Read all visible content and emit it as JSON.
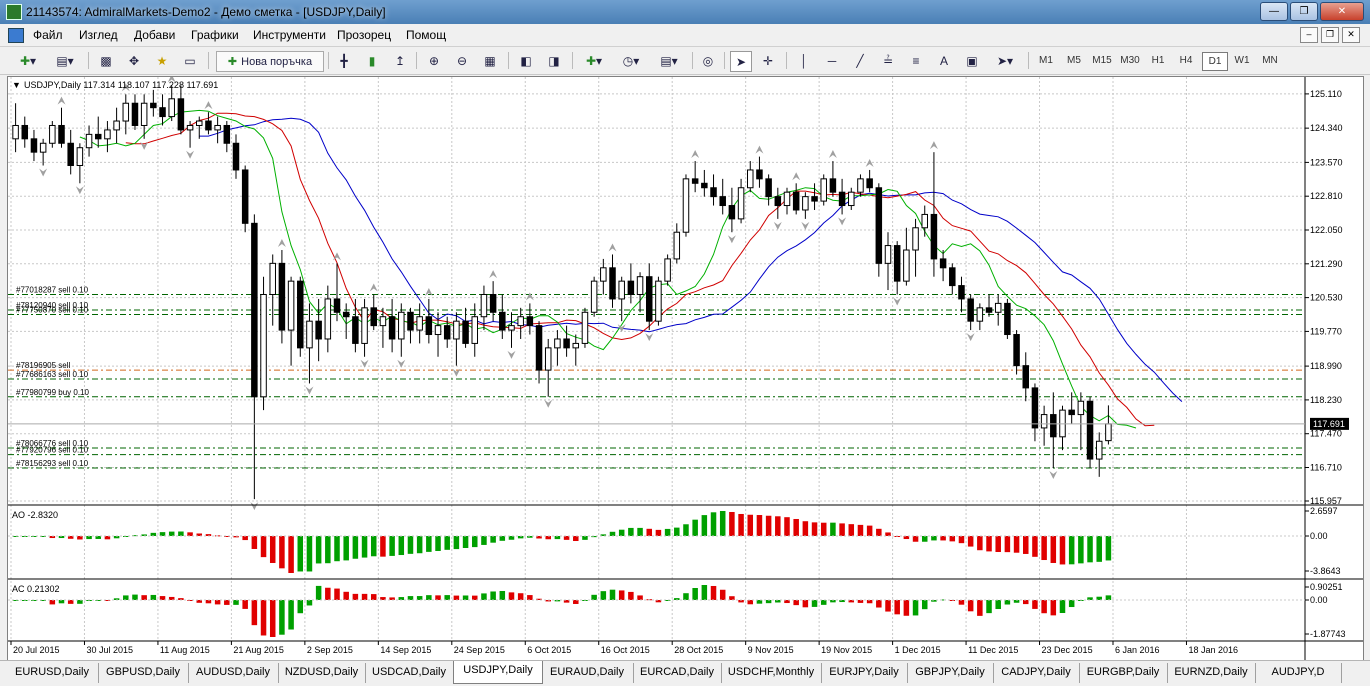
{
  "window": {
    "title": "21143574: AdmiralMarkets-Demo2 - Демо сметка - [USDJPY,Daily]"
  },
  "menu": {
    "items": [
      "Файл",
      "Изглед",
      "Добави",
      "Графики",
      "Инструменти",
      "Прозорец",
      "Помощ"
    ]
  },
  "toolbar": {
    "new_order_label": "Нова поръчка",
    "timeframes": [
      "M1",
      "M5",
      "M15",
      "M30",
      "H1",
      "H4",
      "D1",
      "W1",
      "MN"
    ],
    "active_timeframe": "D1"
  },
  "chart": {
    "header": "USDJPY,Daily  117.314 118.107 117.228 117.691",
    "current_price": "117.691",
    "price_ticks": [
      "125.110",
      "124.340",
      "123.570",
      "122.810",
      "122.050",
      "121.290",
      "120.530",
      "119.770",
      "118.990",
      "118.230",
      "117.470",
      "116.710",
      "115.957"
    ],
    "date_ticks": [
      "20 Jul 2015",
      "30 Jul 2015",
      "11 Aug 2015",
      "21 Aug 2015",
      "2 Sep 2015",
      "14 Sep 2015",
      "24 Sep 2015",
      "6 Oct 2015",
      "16 Oct 2015",
      "28 Oct 2015",
      "9 Nov 2015",
      "19 Nov 2015",
      "1 Dec 2015",
      "11 Dec 2015",
      "23 Dec 2015",
      "6 Jan 2016",
      "18 Jan 2016"
    ],
    "order_labels": [
      "#77018287 sell 0.10",
      "#78120940 sell 0.10",
      "#77750870 sell 0.10",
      "#78196905 sell",
      "#77686163 sell 0.10",
      "#77980799 buy 0.10",
      "#78066776 sell 0.10",
      "#77920796 sell 0.10",
      "#78156293 sell 0.10"
    ],
    "colors": {
      "ma_fast": "#00b000",
      "ma_mid": "#d00000",
      "ma_slow": "#0000c8",
      "order_line": "#006400",
      "order_line_alt": "#d2691e",
      "bull": "#00a000",
      "bear": "#e00000"
    }
  },
  "ao": {
    "label": "AO -2.8320",
    "ticks": [
      "2.6597",
      "0.00",
      "-3.8643"
    ]
  },
  "ac": {
    "label": "AC 0.21302",
    "ticks": [
      "0.90251",
      "0.00",
      "-1.87743"
    ]
  },
  "tabs": [
    "EURUSD,Daily",
    "GBPUSD,Daily",
    "AUDUSD,Daily",
    "NZDUSD,Daily",
    "USDCAD,Daily",
    "USDJPY,Daily",
    "EURAUD,Daily",
    "EURCAD,Daily",
    "USDCHF,Monthly",
    "EURJPY,Daily",
    "GBPJPY,Daily",
    "CADJPY,Daily",
    "EURGBP,Daily",
    "EURNZD,Daily",
    "AUDJPY,D"
  ],
  "active_tab": "USDJPY,Daily",
  "chart_data": {
    "type": "candlestick",
    "symbol": "USDJPY",
    "timeframe": "Daily",
    "ohlc": [
      [
        124.1,
        124.9,
        123.8,
        124.4
      ],
      [
        124.4,
        124.6,
        123.9,
        124.1
      ],
      [
        124.1,
        124.3,
        123.6,
        123.8
      ],
      [
        123.8,
        124.1,
        123.5,
        124.0
      ],
      [
        124.0,
        124.5,
        123.9,
        124.4
      ],
      [
        124.4,
        124.8,
        123.9,
        124.0
      ],
      [
        124.0,
        124.3,
        123.3,
        123.5
      ],
      [
        123.5,
        124.0,
        123.1,
        123.9
      ],
      [
        123.9,
        124.4,
        123.7,
        124.2
      ],
      [
        124.2,
        124.6,
        123.9,
        124.1
      ],
      [
        124.1,
        124.5,
        123.8,
        124.3
      ],
      [
        124.3,
        124.8,
        124.0,
        124.5
      ],
      [
        124.5,
        125.1,
        124.2,
        124.9
      ],
      [
        124.9,
        125.1,
        124.3,
        124.4
      ],
      [
        124.4,
        125.1,
        124.1,
        124.9
      ],
      [
        124.9,
        125.2,
        124.6,
        124.8
      ],
      [
        124.8,
        125.1,
        124.4,
        124.6
      ],
      [
        124.6,
        125.3,
        124.5,
        125.0
      ],
      [
        125.0,
        125.3,
        124.2,
        124.3
      ],
      [
        124.3,
        124.5,
        123.9,
        124.4
      ],
      [
        124.4,
        124.6,
        124.1,
        124.5
      ],
      [
        124.5,
        124.7,
        124.2,
        124.3
      ],
      [
        124.3,
        124.6,
        124.0,
        124.4
      ],
      [
        124.4,
        124.5,
        123.8,
        124.0
      ],
      [
        124.0,
        124.2,
        123.2,
        123.4
      ],
      [
        123.4,
        123.5,
        122.0,
        122.2
      ],
      [
        122.2,
        122.4,
        116.0,
        118.3
      ],
      [
        118.3,
        121.0,
        118.0,
        120.6
      ],
      [
        120.6,
        121.5,
        119.9,
        121.3
      ],
      [
        121.3,
        121.6,
        119.5,
        119.8
      ],
      [
        119.8,
        121.0,
        119.0,
        120.9
      ],
      [
        120.9,
        121.0,
        119.2,
        119.4
      ],
      [
        119.4,
        120.4,
        118.6,
        120.0
      ],
      [
        120.0,
        120.5,
        119.1,
        119.6
      ],
      [
        119.6,
        120.8,
        119.3,
        120.5
      ],
      [
        120.5,
        121.3,
        120.0,
        120.2
      ],
      [
        120.2,
        120.4,
        119.6,
        120.1
      ],
      [
        120.1,
        120.5,
        119.3,
        119.5
      ],
      [
        119.5,
        120.5,
        119.2,
        120.3
      ],
      [
        120.3,
        120.6,
        119.8,
        119.9
      ],
      [
        119.9,
        120.3,
        119.4,
        120.1
      ],
      [
        120.1,
        120.5,
        119.3,
        119.6
      ],
      [
        119.6,
        120.4,
        119.2,
        120.2
      ],
      [
        120.2,
        120.3,
        119.5,
        119.8
      ],
      [
        119.8,
        120.4,
        119.5,
        120.1
      ],
      [
        120.1,
        120.5,
        119.5,
        119.7
      ],
      [
        119.7,
        120.2,
        119.2,
        119.9
      ],
      [
        119.9,
        120.1,
        119.4,
        119.6
      ],
      [
        119.6,
        120.2,
        119.0,
        120.0
      ],
      [
        120.0,
        120.3,
        119.4,
        119.5
      ],
      [
        119.5,
        120.4,
        119.2,
        120.1
      ],
      [
        120.1,
        120.8,
        119.8,
        120.6
      ],
      [
        120.6,
        120.9,
        120.0,
        120.2
      ],
      [
        120.2,
        120.6,
        119.6,
        119.8
      ],
      [
        119.8,
        120.2,
        119.4,
        119.9
      ],
      [
        119.9,
        120.3,
        119.6,
        120.1
      ],
      [
        120.1,
        120.4,
        119.7,
        119.9
      ],
      [
        119.9,
        120.0,
        118.6,
        118.9
      ],
      [
        118.9,
        119.6,
        118.3,
        119.4
      ],
      [
        119.4,
        119.8,
        119.0,
        119.6
      ],
      [
        119.6,
        119.9,
        119.2,
        119.4
      ],
      [
        119.4,
        119.7,
        119.0,
        119.5
      ],
      [
        119.5,
        120.3,
        119.4,
        120.2
      ],
      [
        120.2,
        121.0,
        120.1,
        120.9
      ],
      [
        120.9,
        121.4,
        120.6,
        121.2
      ],
      [
        121.2,
        121.5,
        120.3,
        120.5
      ],
      [
        120.5,
        121.0,
        120.0,
        120.9
      ],
      [
        120.9,
        121.3,
        120.4,
        120.6
      ],
      [
        120.6,
        121.1,
        120.2,
        121.0
      ],
      [
        121.0,
        121.3,
        119.8,
        120.0
      ],
      [
        120.0,
        121.0,
        119.9,
        120.9
      ],
      [
        120.9,
        121.5,
        120.8,
        121.4
      ],
      [
        121.4,
        122.2,
        121.3,
        122.0
      ],
      [
        122.0,
        123.3,
        121.9,
        123.2
      ],
      [
        123.2,
        123.6,
        122.9,
        123.1
      ],
      [
        123.1,
        123.4,
        122.8,
        123.0
      ],
      [
        123.0,
        123.3,
        122.6,
        122.8
      ],
      [
        122.8,
        123.2,
        122.4,
        122.6
      ],
      [
        122.6,
        123.0,
        122.0,
        122.3
      ],
      [
        122.3,
        123.2,
        122.2,
        123.0
      ],
      [
        123.0,
        123.6,
        122.9,
        123.4
      ],
      [
        123.4,
        123.7,
        123.0,
        123.2
      ],
      [
        123.2,
        123.3,
        122.6,
        122.8
      ],
      [
        122.8,
        123.0,
        122.3,
        122.6
      ],
      [
        122.6,
        123.0,
        122.4,
        122.9
      ],
      [
        122.9,
        123.1,
        122.4,
        122.5
      ],
      [
        122.5,
        122.9,
        122.3,
        122.8
      ],
      [
        122.8,
        123.1,
        122.5,
        122.7
      ],
      [
        122.7,
        123.3,
        122.6,
        123.2
      ],
      [
        123.2,
        123.6,
        122.8,
        122.9
      ],
      [
        122.9,
        123.2,
        122.4,
        122.6
      ],
      [
        122.6,
        123.0,
        122.5,
        122.9
      ],
      [
        122.9,
        123.3,
        122.8,
        123.2
      ],
      [
        123.2,
        123.4,
        122.9,
        123.0
      ],
      [
        123.0,
        123.1,
        121.0,
        121.3
      ],
      [
        121.3,
        122.0,
        120.7,
        121.7
      ],
      [
        121.7,
        121.8,
        120.6,
        120.9
      ],
      [
        120.9,
        122.1,
        120.8,
        121.6
      ],
      [
        121.6,
        122.3,
        121.0,
        122.1
      ],
      [
        122.1,
        122.6,
        121.9,
        122.4
      ],
      [
        122.4,
        123.8,
        121.0,
        121.4
      ],
      [
        121.4,
        121.6,
        120.9,
        121.2
      ],
      [
        121.2,
        121.3,
        120.6,
        120.8
      ],
      [
        120.8,
        121.0,
        120.2,
        120.5
      ],
      [
        120.5,
        120.6,
        119.8,
        120.0
      ],
      [
        120.0,
        120.4,
        119.8,
        120.3
      ],
      [
        120.3,
        120.6,
        120.1,
        120.2
      ],
      [
        120.2,
        120.6,
        119.9,
        120.4
      ],
      [
        120.4,
        120.5,
        119.6,
        119.7
      ],
      [
        119.7,
        119.8,
        118.8,
        119.0
      ],
      [
        119.0,
        119.3,
        118.2,
        118.5
      ],
      [
        118.5,
        118.6,
        117.3,
        117.6
      ],
      [
        117.6,
        118.1,
        117.2,
        117.9
      ],
      [
        117.9,
        118.4,
        116.7,
        117.4
      ],
      [
        117.4,
        118.1,
        117.1,
        118.0
      ],
      [
        118.0,
        118.4,
        117.7,
        117.9
      ],
      [
        117.9,
        118.4,
        117.1,
        118.2
      ],
      [
        118.2,
        118.3,
        116.7,
        116.9
      ],
      [
        116.9,
        117.5,
        116.5,
        117.3
      ],
      [
        117.314,
        118.107,
        117.228,
        117.691
      ]
    ],
    "price_range": [
      115.957,
      125.4
    ]
  }
}
